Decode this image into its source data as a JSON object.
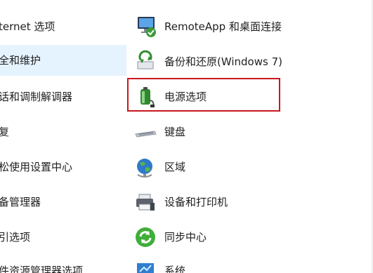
{
  "left_column": {
    "items": [
      {
        "label": "ternet 选项",
        "selected": false
      },
      {
        "label": "全和维护",
        "selected": true
      },
      {
        "label": "话和调制解调器",
        "selected": false
      },
      {
        "label": "复",
        "selected": false
      },
      {
        "label": "松使用设置中心",
        "selected": false
      },
      {
        "label": "备管理器",
        "selected": false
      },
      {
        "label": "引选项",
        "selected": false
      },
      {
        "label": "件资源管理器选项",
        "selected": false
      }
    ]
  },
  "right_column": {
    "items": [
      {
        "label": "RemoteApp 和桌面连接",
        "icon": "remoteapp-icon"
      },
      {
        "label": "备份和还原(Windows 7)",
        "icon": "backup-restore-icon"
      },
      {
        "label": "电源选项",
        "icon": "power-options-icon"
      },
      {
        "label": "键盘",
        "icon": "keyboard-icon"
      },
      {
        "label": "区域",
        "icon": "region-globe-icon"
      },
      {
        "label": "设备和打印机",
        "icon": "devices-printers-icon"
      },
      {
        "label": "同步中心",
        "icon": "sync-center-icon"
      },
      {
        "label": "系统",
        "icon": "system-icon"
      }
    ]
  },
  "annotation": {
    "highlighted_item": "电源选项",
    "color": "#c8181e"
  },
  "colors": {
    "selected_background": "#e5f3ff",
    "text": "#1f1f1f",
    "background": "#ffffff"
  }
}
